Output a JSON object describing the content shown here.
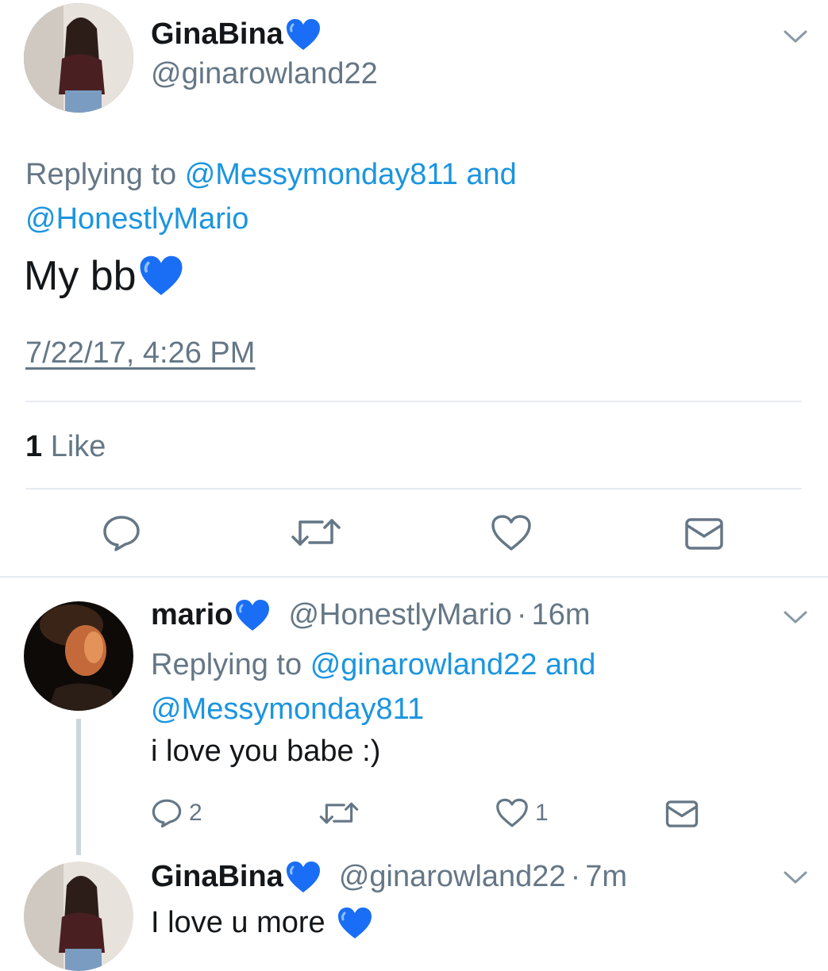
{
  "main_tweet": {
    "name": "GinaBina",
    "handle": "@ginarowland22",
    "replying_prefix": "Replying to",
    "replying_to_1": "@Messymonday811",
    "replying_and": "and",
    "replying_to_2": "@HonestlyMario",
    "text": "My bb",
    "timestamp": "7/22/17, 4:26 PM",
    "likes_count": "1",
    "likes_label": "Like"
  },
  "reply_1": {
    "name": "mario",
    "handle": "@HonestlyMario",
    "time": "16m",
    "separator": "·",
    "replying_prefix": "Replying to",
    "replying_to_1": "@ginarowland22",
    "replying_and": "and",
    "replying_to_2": "@Messymonday811",
    "text": "i love you babe :)",
    "reply_count": "2",
    "like_count": "1"
  },
  "reply_2": {
    "name": "GinaBina",
    "handle": "@ginarowland22",
    "time": "7m",
    "separator": "·",
    "text": "I love u more"
  },
  "colors": {
    "link": "#1b95e0",
    "muted": "#657786",
    "heart_blue": "#1a6ef5"
  }
}
